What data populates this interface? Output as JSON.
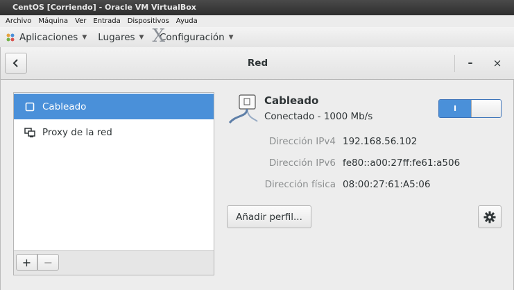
{
  "vbox": {
    "title": "CentOS [Corriendo] - Oracle VM VirtualBox",
    "menu": [
      "Archivo",
      "Máquina",
      "Ver",
      "Entrada",
      "Dispositivos",
      "Ayuda"
    ]
  },
  "panel": {
    "applications": "Aplicaciones",
    "places": "Lugares",
    "settings": "Configuración"
  },
  "window": {
    "title": "Red",
    "minimize": "–",
    "close": "×"
  },
  "sidebar": {
    "items": [
      {
        "label": "Cableado",
        "icon": "wired-network-icon",
        "selected": true
      },
      {
        "label": "Proxy de la red",
        "icon": "network-proxy-icon",
        "selected": false
      }
    ],
    "add": "+",
    "remove": "−"
  },
  "device": {
    "name": "Cableado",
    "status": "Conectado - 1000 Mb/s",
    "switch_on": true,
    "switch_label": "I"
  },
  "details": [
    {
      "label": "Dirección IPv4",
      "value": "192.168.56.102"
    },
    {
      "label": "Dirección IPv6",
      "value": "fe80::a00:27ff:fe61:a506"
    },
    {
      "label": "Dirección física",
      "value": "08:00:27:61:A5:06"
    }
  ],
  "buttons": {
    "add_profile": "Añadir perfil..."
  },
  "colors": {
    "accent": "#4a90d9",
    "window_bg": "#ededed"
  }
}
